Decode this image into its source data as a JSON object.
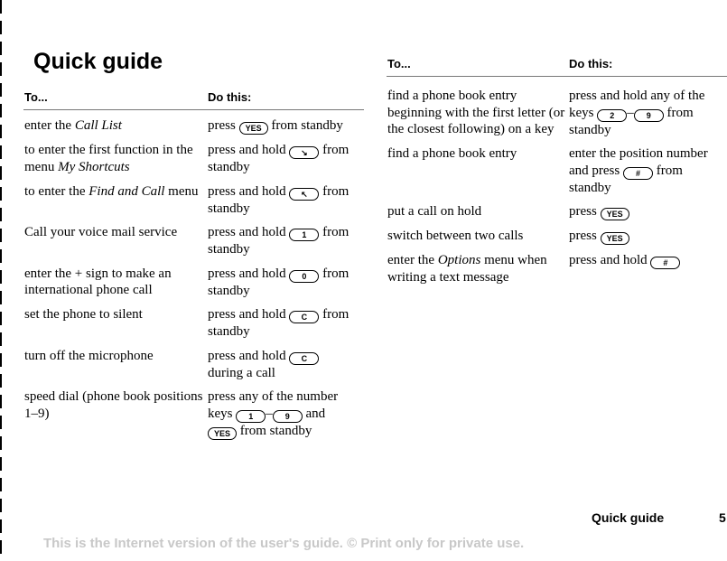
{
  "page": {
    "title": "Quick guide",
    "footer_title": "Quick guide",
    "page_number": "5",
    "watermark": "This is the Internet version of the user's guide. © Print only for private use."
  },
  "table_headers": {
    "to": "To...",
    "do": "Do this:"
  },
  "keys": {
    "yes": "YES",
    "down_arrow": "↘",
    "up_arrow": "↖",
    "k1": "1",
    "k0": "0",
    "kc": "C",
    "k9": "9",
    "k2": "2",
    "hash": "#"
  },
  "left_rows": [
    {
      "to_pre": "enter the ",
      "to_it": "Call List",
      "do_pre": "press ",
      "do_post": " from standby"
    },
    {
      "to_pre": "to enter the first function in the menu ",
      "to_it": "My Shortcuts",
      "do_pre": "press and hold ",
      "do_post": " from standby"
    },
    {
      "to_pre": "to enter the ",
      "to_it": "Find and Call",
      "to_post": " menu",
      "do_pre": "press and hold ",
      "do_post": " from standby"
    },
    {
      "to_pre": "Call your voice mail service",
      "do_pre": "press and hold ",
      "do_post": " from standby"
    },
    {
      "to_pre": "enter the + sign to make an international phone call",
      "do_pre": "press and hold ",
      "do_post": " from standby"
    },
    {
      "to_pre": "set the phone to silent",
      "do_pre": "press and hold ",
      "do_post": " from standby"
    },
    {
      "to_pre": "turn off the microphone",
      "do_pre": "press and hold ",
      "do_post": " during a call"
    },
    {
      "to_pre": "speed dial (phone book positions 1–9)",
      "do_pre": "press any of the number keys ",
      "do_dash": "–",
      "do_mid": " and ",
      "do_post": " from standby"
    }
  ],
  "right_rows": [
    {
      "to_pre": "find a phone book entry beginning with the first letter (or the closest following) on a key",
      "do_pre": "press and hold any of the keys ",
      "do_dash": "–",
      "do_post": " from standby"
    },
    {
      "to_pre": "find a phone book entry",
      "do_pre": "enter the position number and press ",
      "do_post": " from standby"
    },
    {
      "to_pre": "put a call on hold",
      "do_pre": "press "
    },
    {
      "to_pre": "switch between two calls",
      "do_pre": "press "
    },
    {
      "to_pre": "enter the ",
      "to_it": "Options",
      "to_post": " menu when writing a text message",
      "do_pre": "press and hold "
    }
  ]
}
